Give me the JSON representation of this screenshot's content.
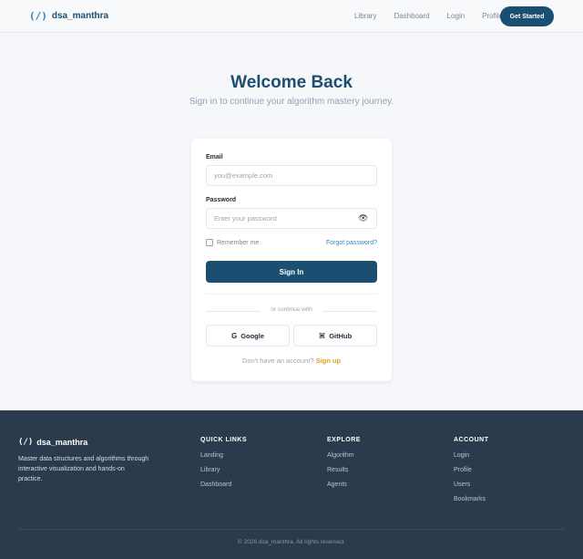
{
  "header": {
    "brand_icon": "(/)",
    "brand_name": "dsa_manthra",
    "nav": [
      "Library",
      "Dashboard",
      "Login",
      "Profile"
    ],
    "cta_label": "Get Started"
  },
  "hero": {
    "title": "Welcome Back",
    "subtitle": "Sign in to continue your algorithm mastery journey."
  },
  "form": {
    "email_label": "Email",
    "email_placeholder": "you@example.com",
    "password_label": "Password",
    "password_placeholder": "Enter your password",
    "password_toggle_icon": "👁",
    "remember_label": "Remember me",
    "forgot_label": "Forgot password?",
    "submit_label": "Sign In",
    "divider_text": "or continue with",
    "google_icon": "G",
    "google_label": "Google",
    "github_icon": "⌘",
    "github_label": "GitHub",
    "signup_prompt": "Don't have an account?",
    "signup_link": "Sign up"
  },
  "footer": {
    "brand_icon": "(/)",
    "brand_name": "dsa_manthra",
    "description": "Master data structures and algorithms through interactive visualization and hands-on practice.",
    "columns": [
      {
        "heading": "QUICK LINKS",
        "links": [
          "Landing",
          "Library",
          "Dashboard"
        ]
      },
      {
        "heading": "EXPLORE",
        "links": [
          "Algorithm",
          "Results",
          "Agents"
        ]
      },
      {
        "heading": "ACCOUNT",
        "links": [
          "Login",
          "Profile",
          "Users",
          "Bookmarks"
        ]
      }
    ],
    "copyright": "© 2026 dsa_manthra. All rights reserved."
  },
  "colors": {
    "primary": "#1b4f72",
    "accent_link": "#2a8ac6",
    "signup_accent": "#e0a01a",
    "footer_bg": "#2b3a4c",
    "page_bg": "#f5f7fa"
  }
}
